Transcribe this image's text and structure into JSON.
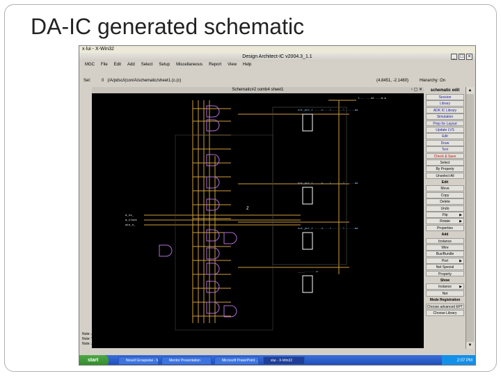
{
  "slide": {
    "title": "DA-IC generated schematic"
  },
  "xterm": {
    "title": "x·lui - X-Win32"
  },
  "window": {
    "title": "Design Architect-IC v2004.3_1.1"
  },
  "menu": [
    "MGC",
    "File",
    "Edit",
    "Add",
    "Select",
    "Setup",
    "Miscellaneous",
    "Report",
    "View",
    "Help"
  ],
  "pathbar": {
    "sel": "Sel:",
    "count": "0",
    "path": "(/A/pdsc/i(con/A/schematic/sheet1.(c.(c)",
    "coords": "(4.8451, -2.1460)",
    "mode": "Hierarchy: On"
  },
  "schematic": {
    "window_title": "Schematic#2 comb4 sheet1",
    "inst_labels": [
      "out_put_1 ....n....l.......l .....aa",
      "out_put_1 ....n....l.......l .....aa",
      "out_put_1 ....n....l.......l .....aa",
      "____.......a"
    ],
    "io_labels": [
      "a_ss_",
      "a_clock",
      "ain_n_"
    ],
    "top_pin": "l... ...al ...a.a",
    "marker": "Z"
  },
  "palette": {
    "header": "schematic edit",
    "items": [
      {
        "label": "Session",
        "style": "blue"
      },
      {
        "label": "Library",
        "style": "blue"
      },
      {
        "label": "ADK IC Library",
        "style": "blue"
      },
      {
        "label": "Simulation",
        "style": "blue"
      },
      {
        "label": "Prep for Layout",
        "style": "blue"
      },
      {
        "label": "Update LVS",
        "style": "blue"
      },
      {
        "label": "Edit",
        "style": "blue"
      },
      {
        "label": "Draw",
        "style": "blue"
      },
      {
        "label": "Text",
        "style": "blue"
      },
      {
        "label": "Check & Save",
        "style": "red"
      },
      {
        "label": "Select",
        "style": ""
      },
      {
        "label": "By Property",
        "style": ""
      },
      {
        "label": "Unselect All",
        "style": ""
      },
      {
        "label": "Edit",
        "style": "hdr"
      },
      {
        "label": "Move",
        "style": ""
      },
      {
        "label": "Copy",
        "style": ""
      },
      {
        "label": "Delete",
        "style": ""
      },
      {
        "label": "Undo",
        "style": ""
      },
      {
        "label": "Flip",
        "style": "",
        "arrow": true
      },
      {
        "label": "Rotate",
        "style": "",
        "arrow": true
      },
      {
        "label": "Properties",
        "style": ""
      },
      {
        "label": "Add",
        "style": "hdr"
      },
      {
        "label": "Instance",
        "style": ""
      },
      {
        "label": "Wire",
        "style": ""
      },
      {
        "label": "Bus/Bundle",
        "style": ""
      },
      {
        "label": "Port",
        "style": "",
        "arrow": true
      },
      {
        "label": "Net Special",
        "style": ""
      },
      {
        "label": "Property",
        "style": ""
      },
      {
        "label": "Show",
        "style": "hdr"
      },
      {
        "label": "Instance",
        "style": "",
        "arrow": true
      },
      {
        "label": "Net",
        "style": ""
      },
      {
        "label": "Mode Registration",
        "style": "hdr"
      },
      {
        "label": "Choose advanced EPT",
        "style": ""
      },
      {
        "label": "Choose Library",
        "style": ""
      }
    ]
  },
  "messages": [
    "Note: /opt/mentor/ICflow2004.3/scripts/_tcp_script_f42370: will reopen: set names in simulation commands",
    "Note: Writing _IXG setting, please wait.",
    "Note: Job list successfully completed."
  ],
  "taskbar": {
    "start": "start",
    "items": [
      "Novell Groupwise - M...",
      "Mentor Presentation",
      "Microsoft PowerPoint ...",
      "xlui - X-Win32"
    ],
    "clock": "2:07 PM"
  },
  "colors": {
    "wire": "#d2a03c",
    "gate": "#b070d8",
    "grid": "#ffffff",
    "label": "#9ad0ff"
  }
}
